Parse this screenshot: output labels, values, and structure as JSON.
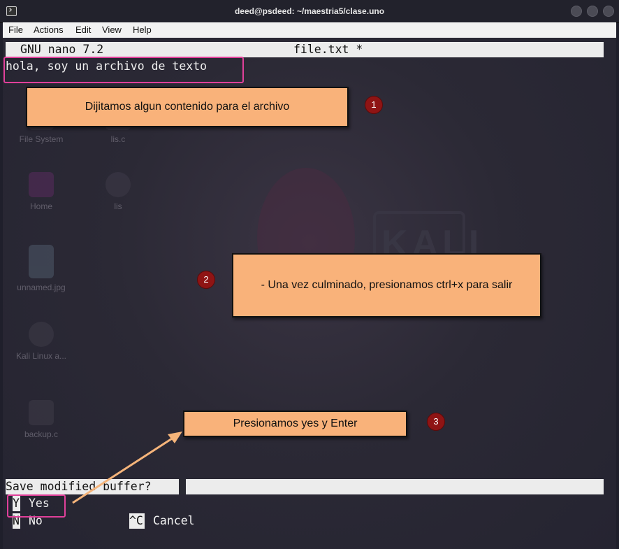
{
  "window": {
    "title": "deed@psdeed: ~/maestria5/clase.uno"
  },
  "menu": [
    {
      "label": "File"
    },
    {
      "label": "Actions"
    },
    {
      "label": "Edit"
    },
    {
      "label": "View"
    },
    {
      "label": "Help"
    }
  ],
  "nano": {
    "version": "GNU nano 7.2",
    "filename": "file.txt *",
    "content": "hola, soy un archivo de texto",
    "prompt": "Save modified buffer? ",
    "options": [
      {
        "key": "Y",
        "label": "Yes"
      },
      {
        "key": "N",
        "label": "No"
      },
      {
        "key": "^C",
        "label": "Cancel"
      }
    ]
  },
  "desktop_icons": [
    {
      "label": "File System",
      "icon": "drive-icon"
    },
    {
      "label": "lis.c",
      "icon": "file-icon"
    },
    {
      "label": "Home",
      "icon": "home-folder-icon"
    },
    {
      "label": "lis",
      "icon": "gear-lock-icon"
    },
    {
      "label": "unnamed.jpg",
      "icon": "image-icon"
    },
    {
      "label": "Kali Linux a...",
      "icon": "disc-icon"
    },
    {
      "label": "backup.c",
      "icon": "locked-file-icon"
    }
  ],
  "callouts": [
    {
      "number": "1",
      "text": "Dijitamos algun contenido para el archivo"
    },
    {
      "number": "2",
      "text": "- Una vez culminado, presionamos ctrl+x para salir"
    },
    {
      "number": "3",
      "text": "Presionamos yes y Enter"
    }
  ],
  "colors": {
    "callout_fill": "#f9b27a",
    "badge": "#8f1414",
    "highlight": "#e0409a",
    "arrow": "#f5b47a"
  }
}
